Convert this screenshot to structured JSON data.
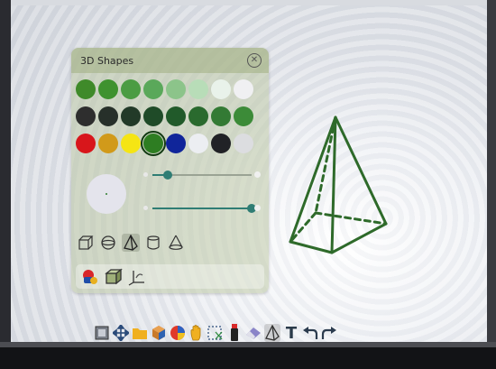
{
  "panel": {
    "title": "3D Shapes",
    "close_icon": "close-circle-icon",
    "swatch_rows": [
      [
        "#3f8a2a",
        "#3f922f",
        "#4b9c43",
        "#5aa85a",
        "#8cc48a",
        "#b8ddb8",
        "#e9f2ea",
        "#f0f0f2"
      ],
      [
        "#2e2e2e",
        "#27302a",
        "#223a28",
        "#1f4b28",
        "#215a2a",
        "#2a6a2e",
        "#337a34",
        "#3c8b38"
      ],
      [
        "#d8161b",
        "#d19a1a",
        "#f5e514",
        "#2e7d22",
        "#10259a",
        "#eceef2",
        "#212226",
        "#dcdde0"
      ]
    ],
    "selected_color": "#2e7d22",
    "brush_size_fraction": 0.15,
    "opacity_fraction": 1.0,
    "shape_tools": [
      "cube-icon",
      "sphere-icon",
      "pyramid-icon",
      "cylinder-icon",
      "cone-icon"
    ],
    "active_shape": "pyramid-icon",
    "bottom_tools": [
      "color-fill-icon",
      "cube-style-icon",
      "axis-icon"
    ]
  },
  "canvas": {
    "shape": "pyramid",
    "stroke_color": "#2e6a2a"
  },
  "toolbar": {
    "icons": [
      "select-icon",
      "move-icon",
      "folder-icon",
      "shapes-icon",
      "color-picker-icon",
      "hand-icon",
      "lasso-select-icon",
      "marker-icon",
      "eraser-icon",
      "3d-shapes-icon",
      "text-icon",
      "undo-icon",
      "redo-icon"
    ],
    "text_tool_label": "T"
  }
}
